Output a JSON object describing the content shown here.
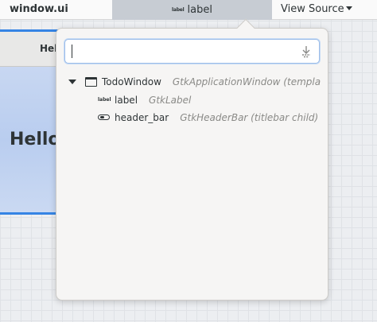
{
  "topbar": {
    "file_title": "window.ui",
    "selected_object_icon": "label",
    "selected_object": "label",
    "view_source_label": "View Source"
  },
  "preview": {
    "header_title": "Hel",
    "hello_text": "Hello"
  },
  "search": {
    "value": "",
    "placeholder": ""
  },
  "tree": {
    "root": {
      "name": "TodoWindow",
      "type": "GtkApplicationWindow  (templa"
    },
    "children": [
      {
        "icon_text": "label",
        "name": "label",
        "type": "GtkLabel"
      },
      {
        "name": "header_bar",
        "type": "GtkHeaderBar  (titlebar child)"
      }
    ]
  },
  "colors": {
    "accent": "#3584e4",
    "selector_bg": "#c7ccd3",
    "popover_bg": "#f6f5f4",
    "type_text": "#8a8a87"
  }
}
